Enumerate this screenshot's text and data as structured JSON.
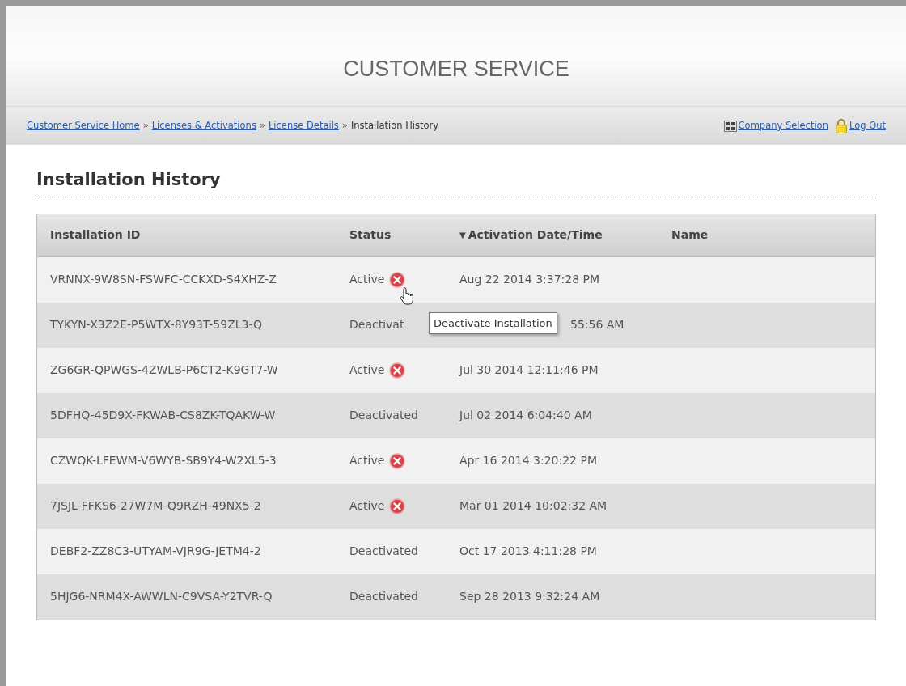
{
  "header": {
    "title": "CUSTOMER SERVICE"
  },
  "breadcrumb": {
    "links": [
      "Customer Service Home",
      "Licenses & Activations",
      "License Details"
    ],
    "separator": "»",
    "current": "Installation History"
  },
  "account_links": [
    "Company Selection",
    "Log Out"
  ],
  "heading": "Installation History",
  "table": {
    "columns": [
      {
        "label": "Installation ID",
        "sorted": false
      },
      {
        "label": "Status",
        "sorted": false
      },
      {
        "label": "Activation Date/Time",
        "sorted": true,
        "sort_icon": "▼"
      },
      {
        "label": "Name",
        "sorted": false
      }
    ],
    "rows": [
      {
        "id": "VRNNX-9W8SN-FSWFC-CCKXD-S4XHZ-Z",
        "status": "Active",
        "can_deactivate": true,
        "date": "Aug 22 2014 3:37:28 PM",
        "hovered": true,
        "covered": false
      },
      {
        "id": "TYKYN-X3Z2E-P5WTX-8Y93T-59ZL3-Q",
        "status": "Deactivat",
        "can_deactivate": false,
        "date": "55:56 AM",
        "hovered": false,
        "covered": true
      },
      {
        "id": "ZG6GR-QPWGS-4ZWLB-P6CT2-K9GT7-W",
        "status": "Active",
        "can_deactivate": true,
        "date": "Jul 30 2014 12:11:46 PM",
        "hovered": false,
        "covered": false
      },
      {
        "id": "5DFHQ-45D9X-FKWAB-CS8ZK-TQAKW-W",
        "status": "Deactivated",
        "can_deactivate": false,
        "date": "Jul 02 2014 6:04:40 AM",
        "hovered": false,
        "covered": false
      },
      {
        "id": "CZWQK-LFEWM-V6WYB-SB9Y4-W2XL5-3",
        "status": "Active",
        "can_deactivate": true,
        "date": "Apr 16 2014 3:20:22 PM",
        "hovered": false,
        "covered": false
      },
      {
        "id": "7JSJL-FFKS6-27W7M-Q9RZH-49NX5-2",
        "status": "Active",
        "can_deactivate": true,
        "date": "Mar 01 2014 10:02:32 AM",
        "hovered": false,
        "covered": false
      },
      {
        "id": "DEBF2-ZZ8C3-UTYAM-VJR9G-JETM4-2",
        "status": "Deactivated",
        "can_deactivate": false,
        "date": "Oct 17 2013 4:11:28 PM",
        "hovered": false,
        "covered": false
      },
      {
        "id": "5HJG6-NRM4X-AWWLN-C9VSA-Y2TVR-Q",
        "status": "Deactivated",
        "can_deactivate": false,
        "date": "Sep 28 2013 9:32:24 AM",
        "hovered": false,
        "covered": false
      }
    ]
  },
  "tooltip": {
    "text": "Deactivate Installation"
  }
}
